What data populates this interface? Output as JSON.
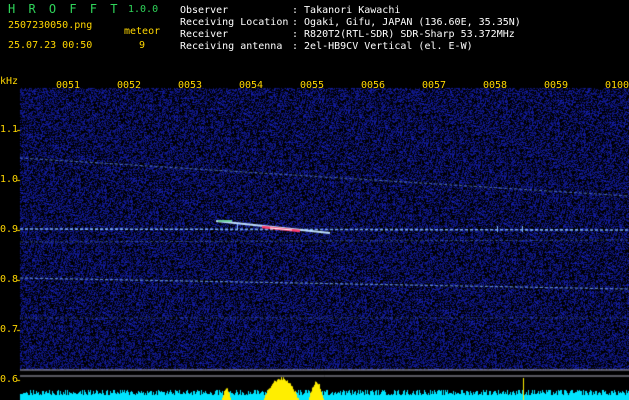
{
  "app": {
    "title_letters": "H R O F F T",
    "version": "1.0.0",
    "filename": "2507230050.png",
    "datetime": "25.07.23 00:50",
    "detector_label": "meteor",
    "detector_count": "9"
  },
  "info": {
    "observer_label": "Observer",
    "observer_value": ": Takanori Kawachi",
    "location_label": "Receiving Location",
    "location_value": ": Ogaki, Gifu, JAPAN (136.60E, 35.35N)",
    "receiver_label": "Receiver",
    "receiver_value": ": R820T2(RTL-SDR) SDR-Sharp 53.372MHz",
    "antenna_label": "Receiving antenna",
    "antenna_value": ": 2el-HB9CV Vertical (el. E-W)"
  },
  "axes": {
    "unit": "kHz",
    "time_ticks": [
      "0051",
      "0052",
      "0053",
      "0054",
      "0055",
      "0056",
      "0057",
      "0058",
      "0059",
      "0100"
    ],
    "freq_ticks": [
      "1.1",
      "1.0",
      "0.9",
      "0.8",
      "0.7",
      "0.6"
    ]
  },
  "colors": {
    "background": "#000000",
    "noise": "#1a2a9c",
    "trace": "#7fb6ff",
    "meteor_hot": "#ff3b6b",
    "label_yellow": "#ffd700",
    "title_green": "#2fd55a",
    "spectrum_cyan": "#00e5ff",
    "spectrum_yellow": "#ffee00"
  }
}
